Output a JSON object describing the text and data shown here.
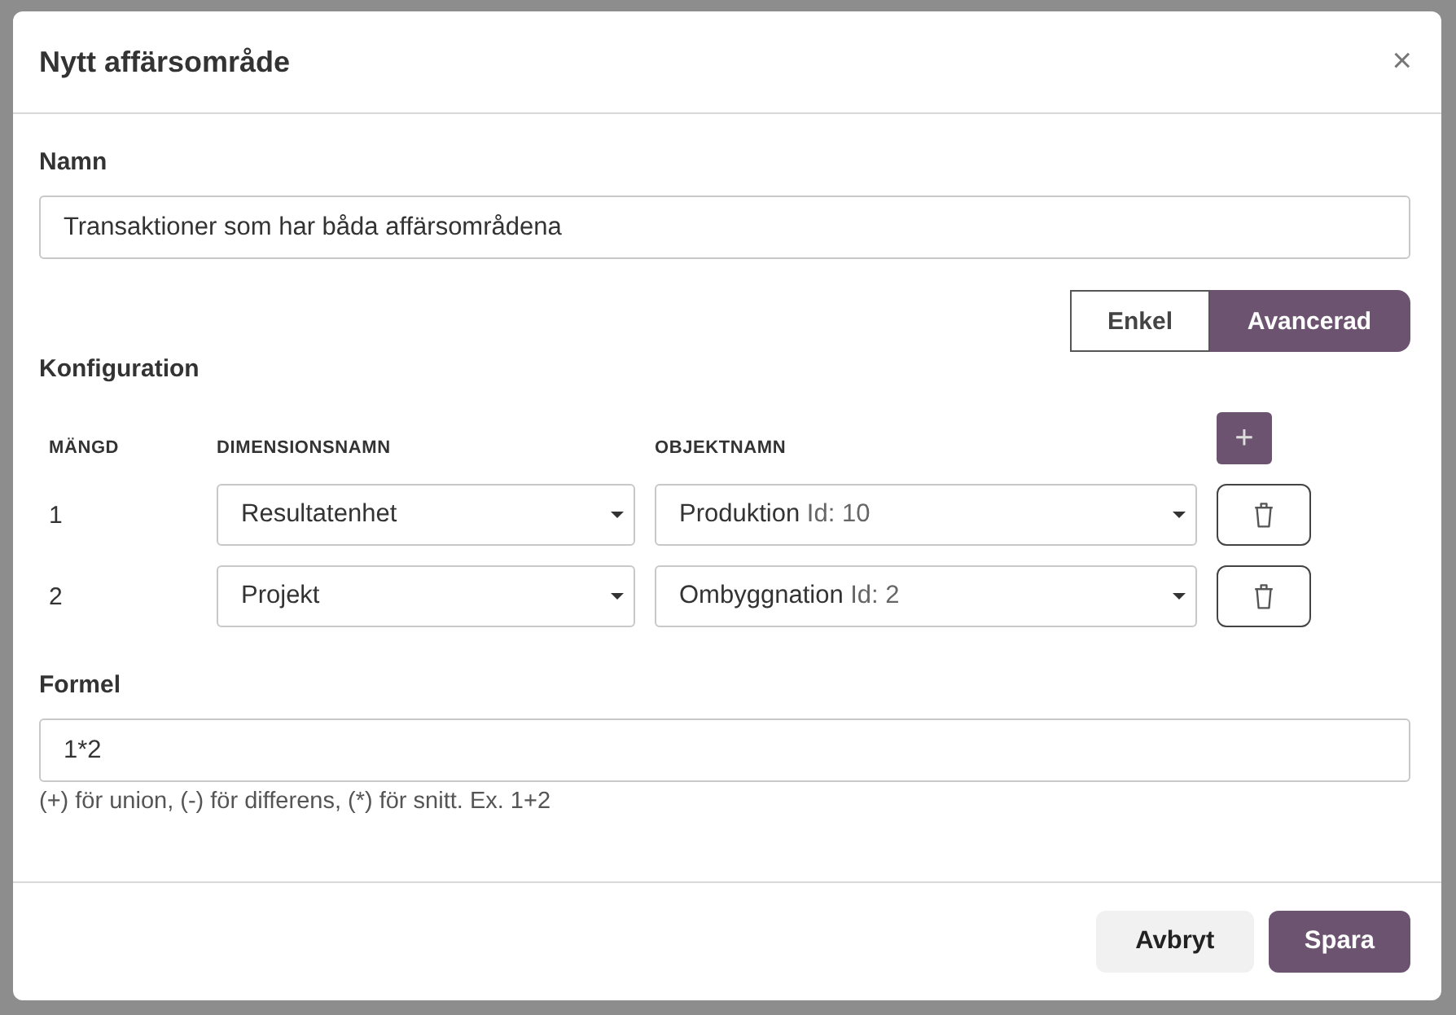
{
  "dialog": {
    "title": "Nytt affärsområde",
    "close": "×"
  },
  "name_field": {
    "label": "Namn",
    "value": "Transaktioner som har båda affärsområdena"
  },
  "mode_toggle": [
    {
      "label": "Enkel",
      "selected": false
    },
    {
      "label": "Avancerad",
      "selected": true
    }
  ],
  "configuration": {
    "title": "Konfiguration",
    "columns": [
      "MÄNGD",
      "DIMENSIONSNAMN",
      "OBJEKTNAMN"
    ],
    "add_button": "+",
    "rows": [
      {
        "set": "1",
        "dimension": "Resultatenhet",
        "object_name": "Produktion",
        "object_id": "Id: 10"
      },
      {
        "set": "2",
        "dimension": "Projekt",
        "object_name": "Ombyggnation",
        "object_id": "Id: 2"
      }
    ]
  },
  "formula_field": {
    "label": "Formel",
    "value": "1*2",
    "help": "(+) för union, (-) för differens, (*) för snitt. Ex. 1+2"
  },
  "buttons": [
    {
      "label": "Avbryt",
      "kind": "secondary"
    },
    {
      "label": "Spara",
      "kind": "primary"
    }
  ]
}
